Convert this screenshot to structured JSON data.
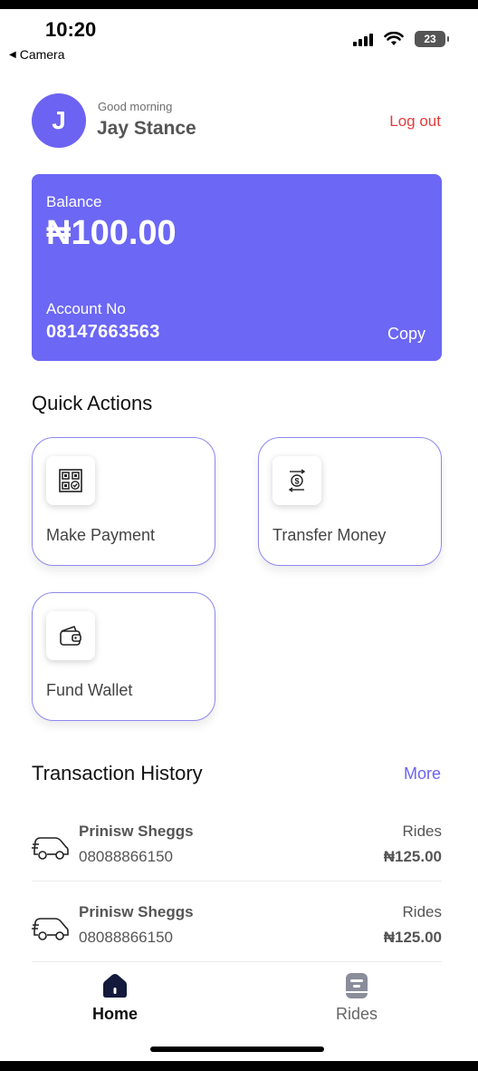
{
  "status_bar": {
    "time": "10:20",
    "back_label": "Camera",
    "battery": "23"
  },
  "header": {
    "avatar_initial": "J",
    "greeting": "Good morning",
    "name": "Jay Stance",
    "logout_label": "Log out"
  },
  "balance_card": {
    "balance_label": "Balance",
    "balance_value": "₦100.00",
    "account_label": "Account No",
    "account_number": "08147663563",
    "copy_label": "Copy",
    "color": "#6c67f4"
  },
  "quick_actions": {
    "title": "Quick Actions",
    "items": [
      {
        "label": "Make Payment",
        "icon": "qr-scan-icon"
      },
      {
        "label": "Transfer Money",
        "icon": "money-transfer-icon"
      },
      {
        "label": "Fund Wallet",
        "icon": "wallet-icon"
      }
    ]
  },
  "transactions": {
    "title": "Transaction History",
    "more_label": "More",
    "items": [
      {
        "name": "Prinisw Sheggs",
        "phone": "08088866150",
        "category": "Rides",
        "amount": "₦125.00",
        "icon": "car-icon"
      },
      {
        "name": "Prinisw Sheggs",
        "phone": "08088866150",
        "category": "Rides",
        "amount": "₦125.00",
        "icon": "car-icon"
      }
    ]
  },
  "bottom_nav": {
    "items": [
      {
        "label": "Home",
        "icon": "home-icon",
        "active": true
      },
      {
        "label": "Rides",
        "icon": "rides-icon",
        "active": false
      }
    ]
  },
  "colors": {
    "accent": "#6c63f2",
    "logout": "#e23c3c"
  }
}
